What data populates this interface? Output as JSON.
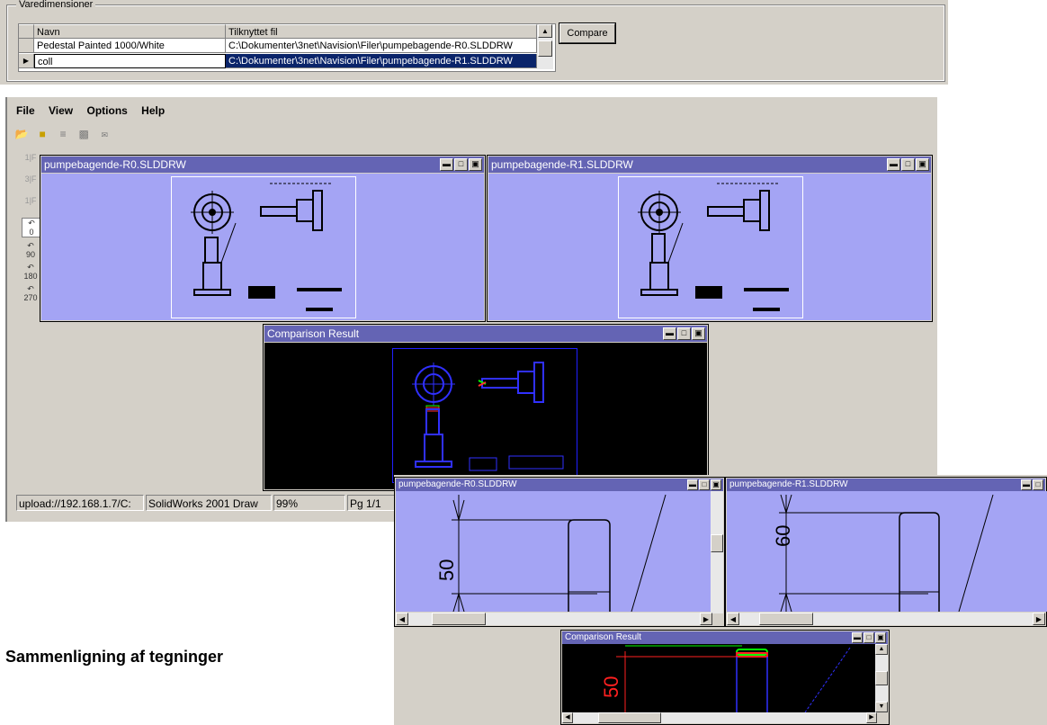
{
  "top": {
    "group_label": "Varedimensioner",
    "columns": [
      "Navn",
      "Tilknyttet fil"
    ],
    "rows": [
      {
        "navn": "Pedestal Painted 1000/White",
        "fil": "C:\\Dokumenter\\3net\\Navision\\Filer\\pumpebagende-R0.SLDDRW"
      },
      {
        "navn": "coll",
        "fil": "C:\\Dokumenter\\3net\\Navision\\Filer\\pumpebagende-R1.SLDDRW"
      }
    ],
    "compare_label": "Compare"
  },
  "app": {
    "menu": [
      "File",
      "View",
      "Options",
      "Help"
    ],
    "toolbar_icons": [
      "open-icon",
      "open-folder-icon",
      "layers-icon",
      "print-icon",
      "mail-icon"
    ],
    "left_tools": [
      {
        "icon": "flip-horizontal-icon",
        "label": "1|F"
      },
      {
        "icon": "flip-vertical-icon",
        "label": "3|F"
      },
      {
        "icon": "mirror-icon",
        "label": "1|F"
      },
      {
        "icon": "rotate-0-icon",
        "label": "0"
      },
      {
        "icon": "rotate-90-icon",
        "label": "90"
      },
      {
        "icon": "rotate-180-icon",
        "label": "180"
      },
      {
        "icon": "rotate-270-icon",
        "label": "270"
      }
    ],
    "windows": {
      "r0": "pumpebagende-R0.SLDDRW",
      "r1": "pumpebagende-R1.SLDDRW",
      "result": "Comparison Result"
    },
    "status": {
      "path": "upload://192.168.1.7/C:",
      "app": "SolidWorks 2001 Draw",
      "zoom": "99%",
      "page": "Pg 1/1"
    }
  },
  "zoom": {
    "r0_title": "pumpebagende-R0.SLDDRW",
    "r1_title": "pumpebagende-R1.SLDDRW",
    "result_title": "Comparison Result",
    "dim_r0": "50",
    "dim_r1": "60",
    "dim_result": "50"
  },
  "caption": "Sammenligning af tegninger",
  "colors": {
    "title_bar": "#6464b4",
    "drawing_bg": "#a4a4f4",
    "selection": "#0a246a",
    "chrome": "#d4d0c8"
  }
}
